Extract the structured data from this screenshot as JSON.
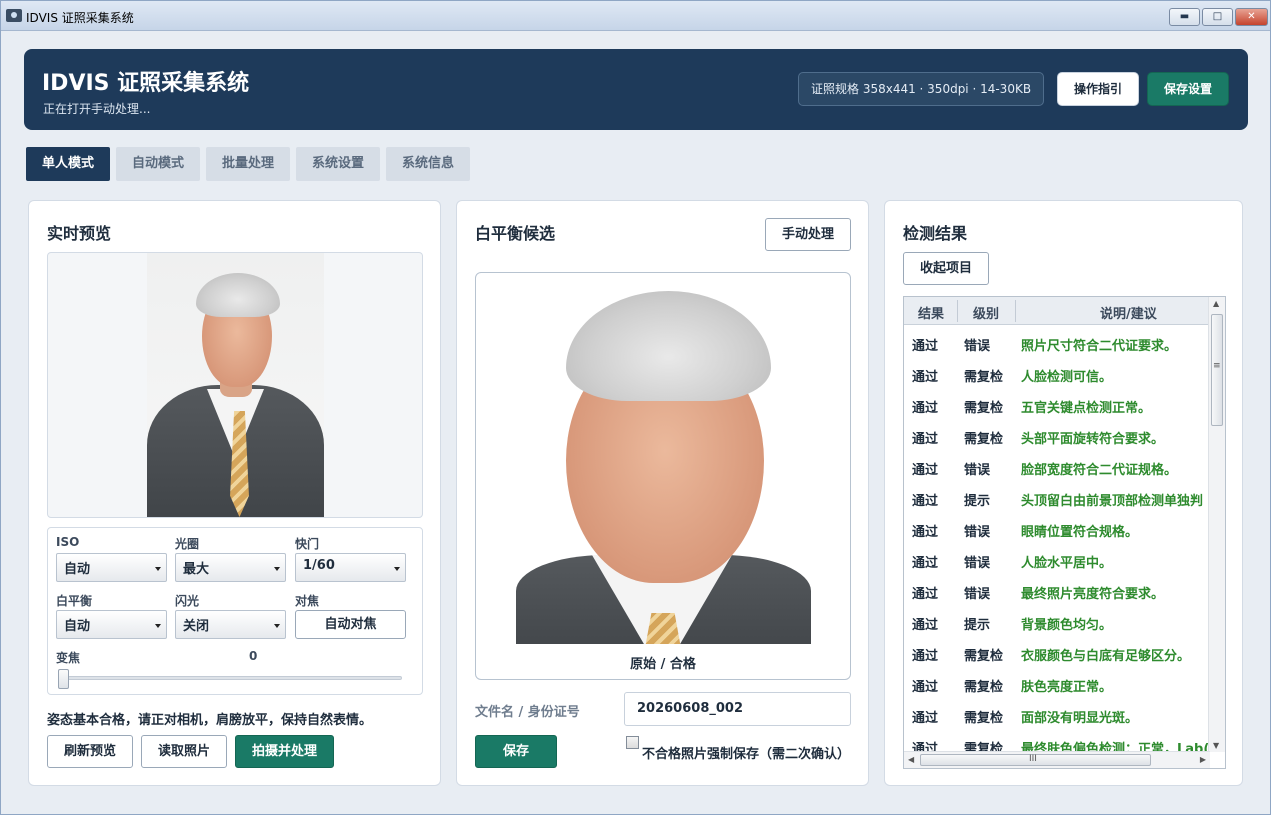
{
  "window": {
    "title": "IDVIS 证照采集系统",
    "controls": {
      "minimize": "▬",
      "maximize": "□",
      "close": "✕"
    }
  },
  "header": {
    "title": "IDVIS 证照采集系统",
    "status": "正在打开手动处理...",
    "spec": "证照规格 358x441 · 350dpi · 14-30KB",
    "guide_label": "操作指引",
    "save_settings_label": "保存设置"
  },
  "tabs": [
    {
      "label": "单人模式",
      "active": true
    },
    {
      "label": "自动模式",
      "active": false
    },
    {
      "label": "批量处理",
      "active": false
    },
    {
      "label": "系统设置",
      "active": false
    },
    {
      "label": "系统信息",
      "active": false
    }
  ],
  "preview": {
    "title": "实时预览",
    "iso_label": "ISO",
    "iso_value": "自动",
    "aperture_label": "光圈",
    "aperture_value": "最大",
    "shutter_label": "快门",
    "shutter_value": "1/60",
    "wb_label": "白平衡",
    "wb_value": "自动",
    "flash_label": "闪光",
    "flash_value": "关闭",
    "focus_label": "对焦",
    "autofocus_label": "自动对焦",
    "zoom_label": "变焦",
    "zoom_value": "0",
    "hint": "姿态基本合格，请正对相机，肩膀放平，保持自然表情。",
    "refresh_label": "刷新预览",
    "read_label": "读取照片",
    "capture_label": "拍摄并处理"
  },
  "wb": {
    "title": "白平衡候选",
    "manual_label": "手动处理",
    "caption": "原始 / 合格",
    "file_label": "文件名 / 身份证号",
    "file_value": "20260608_002",
    "save_label": "保存",
    "force_save_label": "不合格照片强制保存（需二次确认）"
  },
  "results": {
    "title": "检测结果",
    "collapse_label": "收起项目",
    "columns": [
      "结果",
      "级别",
      "说明/建议"
    ],
    "rows": [
      {
        "result": "通过",
        "level": "错误",
        "desc": "照片尺寸符合二代证要求。"
      },
      {
        "result": "通过",
        "level": "需复检",
        "desc": "人脸检测可信。"
      },
      {
        "result": "通过",
        "level": "需复检",
        "desc": "五官关键点检测正常。"
      },
      {
        "result": "通过",
        "level": "需复检",
        "desc": "头部平面旋转符合要求。"
      },
      {
        "result": "通过",
        "level": "错误",
        "desc": "脸部宽度符合二代证规格。"
      },
      {
        "result": "通过",
        "level": "提示",
        "desc": "头顶留白由前景顶部检测单独判"
      },
      {
        "result": "通过",
        "level": "错误",
        "desc": "眼睛位置符合规格。"
      },
      {
        "result": "通过",
        "level": "错误",
        "desc": "人脸水平居中。"
      },
      {
        "result": "通过",
        "level": "错误",
        "desc": "最终照片亮度符合要求。"
      },
      {
        "result": "通过",
        "level": "提示",
        "desc": "背景颜色均匀。"
      },
      {
        "result": "通过",
        "level": "需复检",
        "desc": "衣服颜色与白底有足够区分。"
      },
      {
        "result": "通过",
        "level": "需复检",
        "desc": "肤色亮度正常。"
      },
      {
        "result": "通过",
        "level": "需复检",
        "desc": "面部没有明显光斑。"
      },
      {
        "result": "通过",
        "level": "需复检",
        "desc": "最终肤色偏色检测：正常，Lab("
      }
    ],
    "hscroll_grip": "III",
    "vscroll_grip": "≡"
  },
  "colors": {
    "navy": "#1e3a5a",
    "green_button": "#1a7a66",
    "pass_text": "#2e8b2e"
  }
}
